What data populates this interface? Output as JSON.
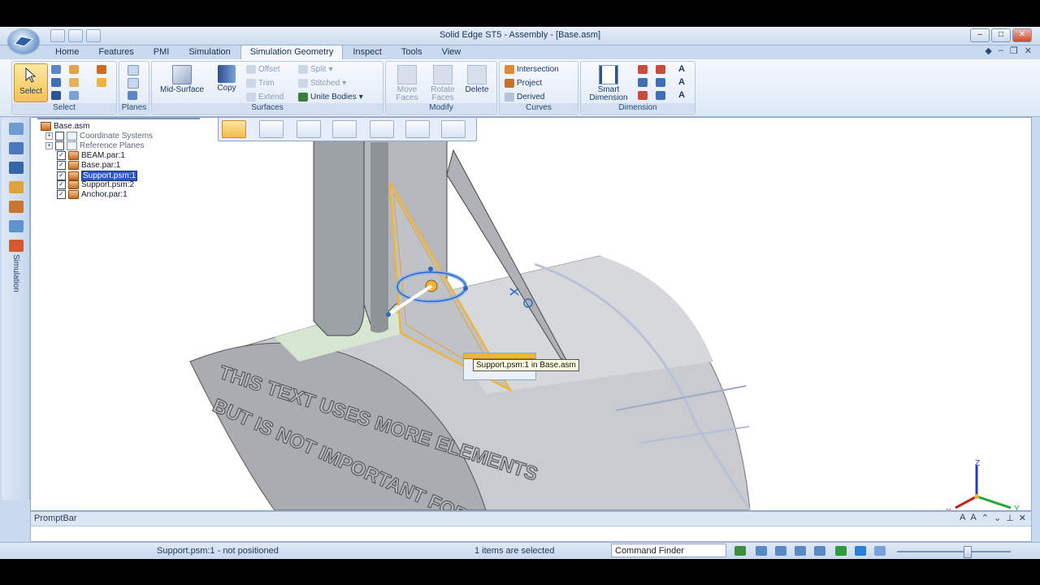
{
  "window": {
    "title": "Solid Edge ST5 - Assembly - [Base.asm]",
    "controls": [
      "–",
      "□",
      "✕"
    ]
  },
  "ribbon": {
    "tabs": [
      "Home",
      "Features",
      "PMI",
      "Simulation",
      "Simulation Geometry",
      "Inspect",
      "Tools",
      "View"
    ],
    "active_tab": "Simulation Geometry",
    "groups": {
      "select": {
        "label": "Select",
        "select_button": "Select"
      },
      "planes": {
        "label": "Planes"
      },
      "surfaces": {
        "label": "Surfaces",
        "mid_surface": "Mid-Surface",
        "copy": "Copy",
        "offset": "Offset",
        "trim": "Trim",
        "extend": "Extend",
        "split": "Split",
        "stitched": "Stitched",
        "unite_bodies": "Unite Bodies"
      },
      "modify": {
        "label": "Modify",
        "move_faces": "Move Faces",
        "rotate_faces": "Rotate Faces",
        "delete": "Delete"
      },
      "curves": {
        "label": "Curves",
        "intersection": "Intersection",
        "project": "Project",
        "derived": "Derived"
      },
      "dimension": {
        "label": "Dimension",
        "smart_dimension": "Smart Dimension"
      }
    }
  },
  "left_toolbar": {
    "simulation_label": "Simulation"
  },
  "pathfinder": {
    "root": "Base.asm",
    "items": [
      {
        "label": "Coordinate Systems",
        "checked": false,
        "expandable": true
      },
      {
        "label": "Reference Planes",
        "checked": false,
        "expandable": true
      },
      {
        "label": "BEAM.par:1",
        "checked": true
      },
      {
        "label": "Base.par:1",
        "checked": true
      },
      {
        "label": "Support.psm:1",
        "checked": true,
        "selected": true
      },
      {
        "label": "Support.psm:2",
        "checked": true
      },
      {
        "label": "Anchor.par:1",
        "checked": true
      }
    ]
  },
  "viewport": {
    "tooltip": "Support.psm:1 in Base.asm",
    "engraved_text_line1": "THIS TEXT USES MORE ELEMENTS",
    "engraved_text_line2": "BUT IS NOT IMPORTANT FOR THE",
    "triad": {
      "x": "X",
      "y": "Y",
      "z": "Z"
    }
  },
  "promptbar": {
    "title": "PromptBar",
    "value": ""
  },
  "statusbar": {
    "left_text": "Support.psm:1 - not positioned",
    "selection_text": "1 items are selected",
    "command_finder": "Command Finder"
  },
  "colors": {
    "accent_selected": "#2a56c6",
    "highlight_orange": "#f0b43a",
    "ribbon_bg": "#dde8f5"
  }
}
